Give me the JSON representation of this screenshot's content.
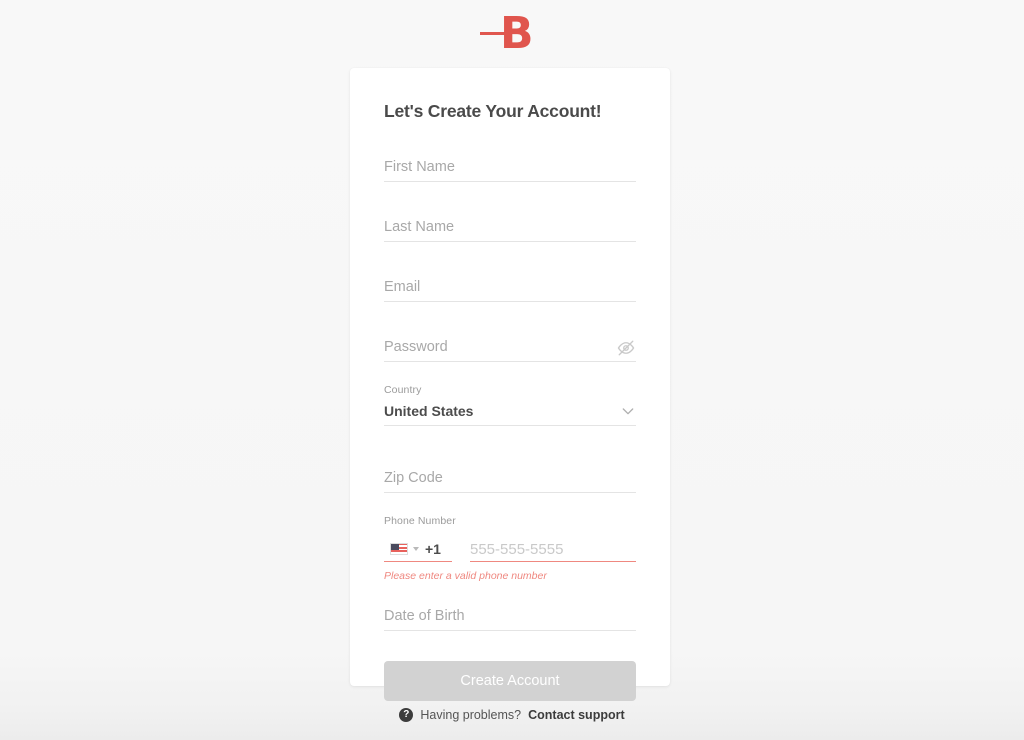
{
  "brand": {
    "logo_letter": "B",
    "logo_icon": "brand-logo-b",
    "logo_color": "#e0554d"
  },
  "card": {
    "title": "Let's Create Your Account!"
  },
  "fields": {
    "first_name": {
      "placeholder": "First Name",
      "value": ""
    },
    "last_name": {
      "placeholder": "Last Name",
      "value": ""
    },
    "email": {
      "placeholder": "Email",
      "value": ""
    },
    "password": {
      "placeholder": "Password",
      "value": "",
      "toggle_icon": "eye-off-icon"
    },
    "country": {
      "label": "Country",
      "value": "United States",
      "chevron_icon": "chevron-down-icon"
    },
    "zip_code": {
      "placeholder": "Zip Code",
      "value": ""
    },
    "phone": {
      "label": "Phone Number",
      "flag_icon": "us-flag-icon",
      "dial_code": "+1",
      "placeholder": "555-555-5555",
      "value": "",
      "error": "Please enter a valid phone number",
      "error_color": "#ef8880"
    },
    "date_of_birth": {
      "placeholder": "Date of Birth",
      "value": ""
    }
  },
  "submit": {
    "label": "Create Account",
    "disabled": true,
    "color": "#d2d2d2"
  },
  "footer": {
    "help_icon": "question-mark-icon",
    "text": "Having problems?",
    "link": "Contact support"
  }
}
